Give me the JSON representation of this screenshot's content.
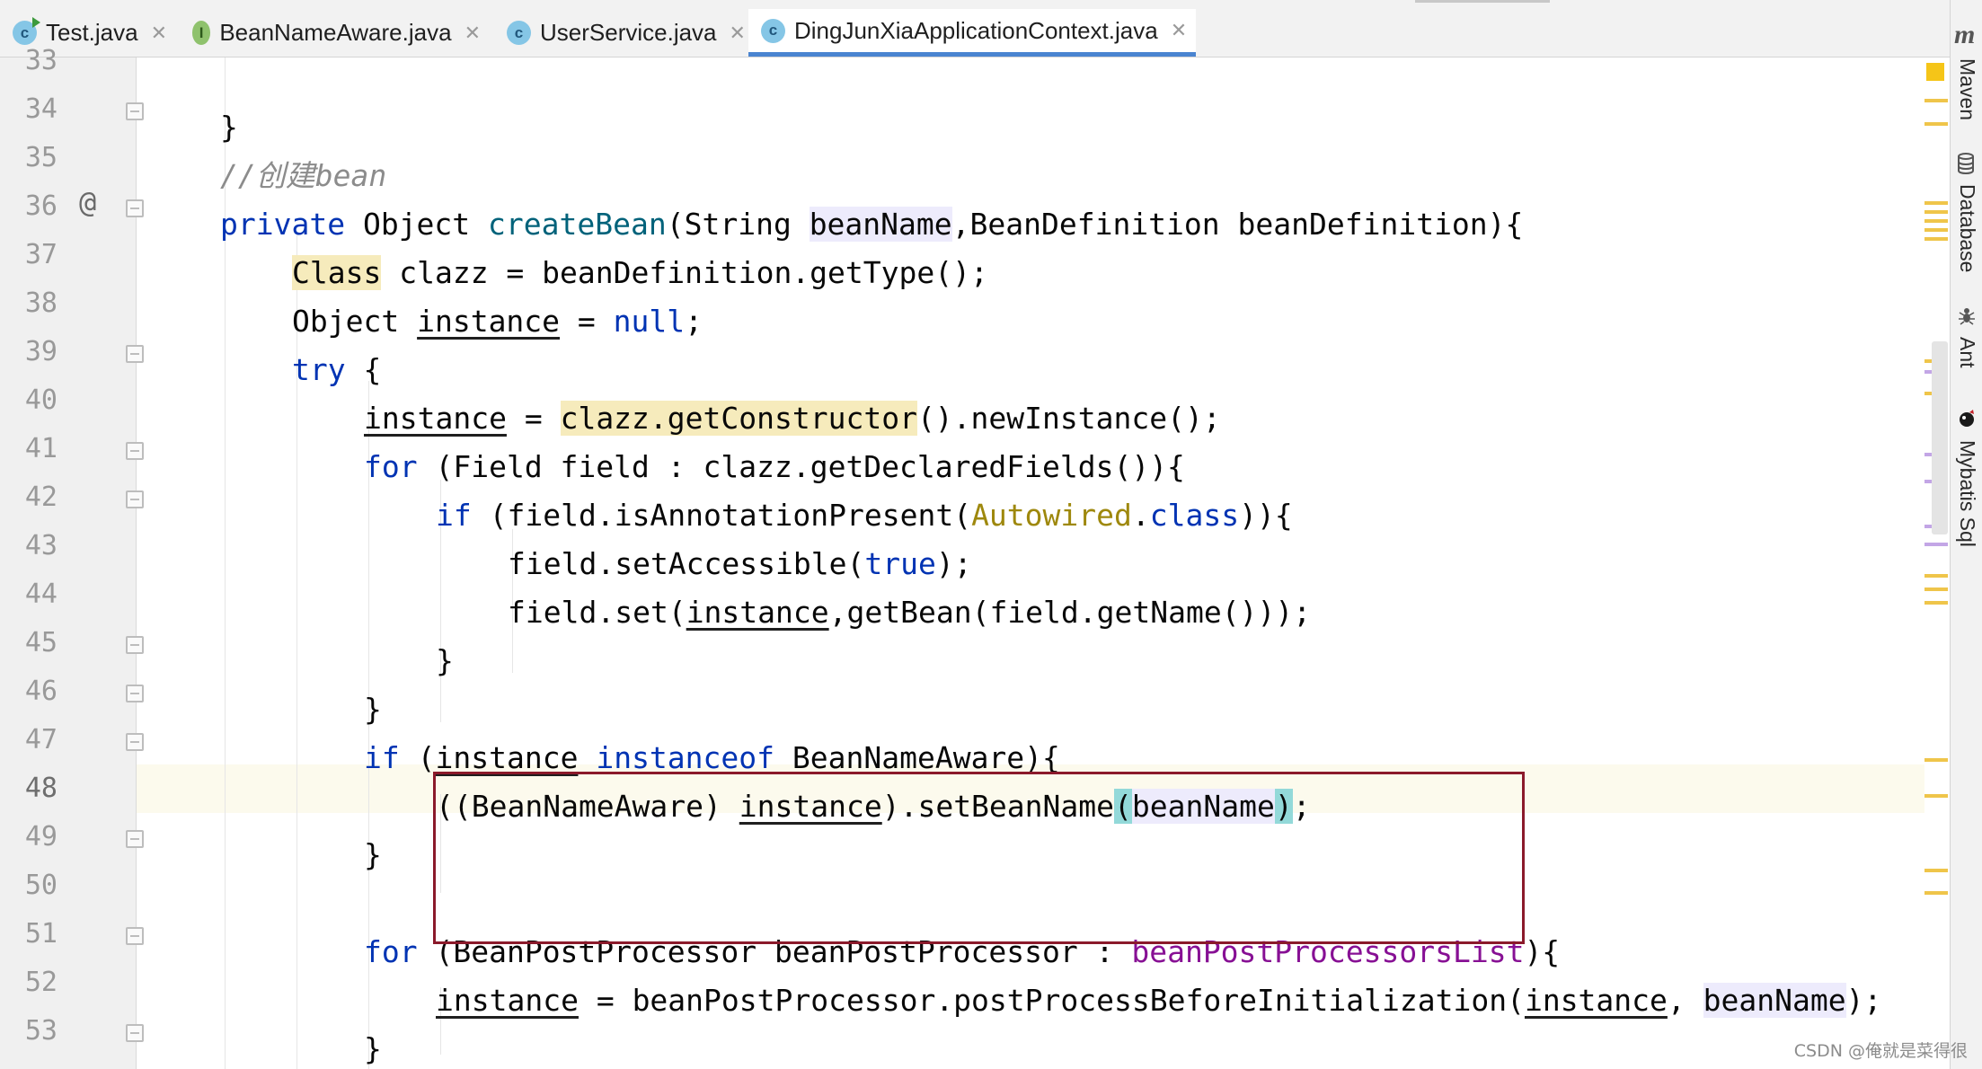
{
  "tabs": [
    {
      "label": "Test.java",
      "icon": "c-class-run-icon",
      "active": false
    },
    {
      "label": "BeanNameAware.java",
      "icon": "interface-icon",
      "active": false
    },
    {
      "label": "UserService.java",
      "icon": "class-icon",
      "active": false
    },
    {
      "label": "DingJunXiaApplicationContext.java",
      "icon": "class-icon",
      "active": true
    }
  ],
  "tab_icon_letters": {
    "class": "c",
    "interface": "I"
  },
  "close_glyph": "✕",
  "gutter_at_symbol": "@",
  "line_numbers": [
    "33",
    "34",
    "35",
    "36",
    "37",
    "38",
    "39",
    "40",
    "41",
    "42",
    "43",
    "44",
    "45",
    "46",
    "47",
    "48",
    "49",
    "50",
    "51",
    "52",
    "53"
  ],
  "code": {
    "l34_brace": "}",
    "l35_comment": "//创建bean",
    "l36": {
      "kw": "private",
      "t1": "Object",
      "fn": "createBean",
      "t2": "(String",
      "p1": "beanName",
      "t3": ",BeanDefinition beanDefinition){"
    },
    "l37": {
      "cls": "Class",
      "t1": "clazz = beanDefinition.getType();"
    },
    "l38": {
      "t1": "Object",
      "var": "instance",
      "t2": "=",
      "kw": "null",
      "t3": ";"
    },
    "l39": {
      "kw": "try",
      "t1": "{"
    },
    "l40": {
      "var": "instance",
      "t1": "=",
      "hl": "clazz.getConstructor",
      "t2": "().newInstance();"
    },
    "l41": {
      "kw": "for",
      "t1": "(Field field : clazz.getDeclaredFields()){"
    },
    "l42": {
      "kw": "if",
      "t1": "(field.isAnnotationPresent(",
      "an": "Autowired",
      "t2": ".",
      "kw2": "class",
      "t3": ")){"
    },
    "l43": {
      "t1": "field.setAccessible(",
      "kw": "true",
      "t2": ");"
    },
    "l44": {
      "t1": "field.set(",
      "var": "instance",
      "t2": ",getBean(field.getName()));"
    },
    "l45_brace": "}",
    "l46_brace": "}",
    "l47": {
      "kw": "if",
      "t1": "(",
      "var": "instance",
      "kw2": "instanceof",
      "t2": "BeanNameAware){"
    },
    "l48": {
      "t1": "((BeanNameAware)",
      "var": "instance",
      "t2": ").setBeanName",
      "b1": "(",
      "p1": "beanName",
      "b2": ")",
      "t3": ";"
    },
    "l49_brace": "}",
    "l51": {
      "kw": "for",
      "t1": "(BeanPostProcessor beanPostProcessor :",
      "fld": "beanPostProcessorsList",
      "t2": "){"
    },
    "l52": {
      "var": "instance",
      "t1": "= beanPostProcessor.postProcessBeforeInitialization(",
      "var2": "instance",
      "t2": ",",
      "p1": "beanName",
      "t3": ");"
    },
    "l53_brace": "}"
  },
  "tool_windows": [
    {
      "label": "Maven",
      "icon": "maven-icon"
    },
    {
      "label": "Database",
      "icon": "database-icon"
    },
    {
      "label": "Ant",
      "icon": "ant-icon"
    },
    {
      "label": "Mybatis Sql",
      "icon": "mybatis-icon"
    }
  ],
  "tool_logo": "m",
  "watermark": "CSDN @俺就是菜得很",
  "colors": {
    "keyword": "#0033b3",
    "method": "#00627a",
    "comment": "#8c8c8c",
    "annotation": "#9e880d",
    "field": "#871094",
    "highlight_box": "#8b1a2b",
    "active_tab": "#4a84d0"
  }
}
